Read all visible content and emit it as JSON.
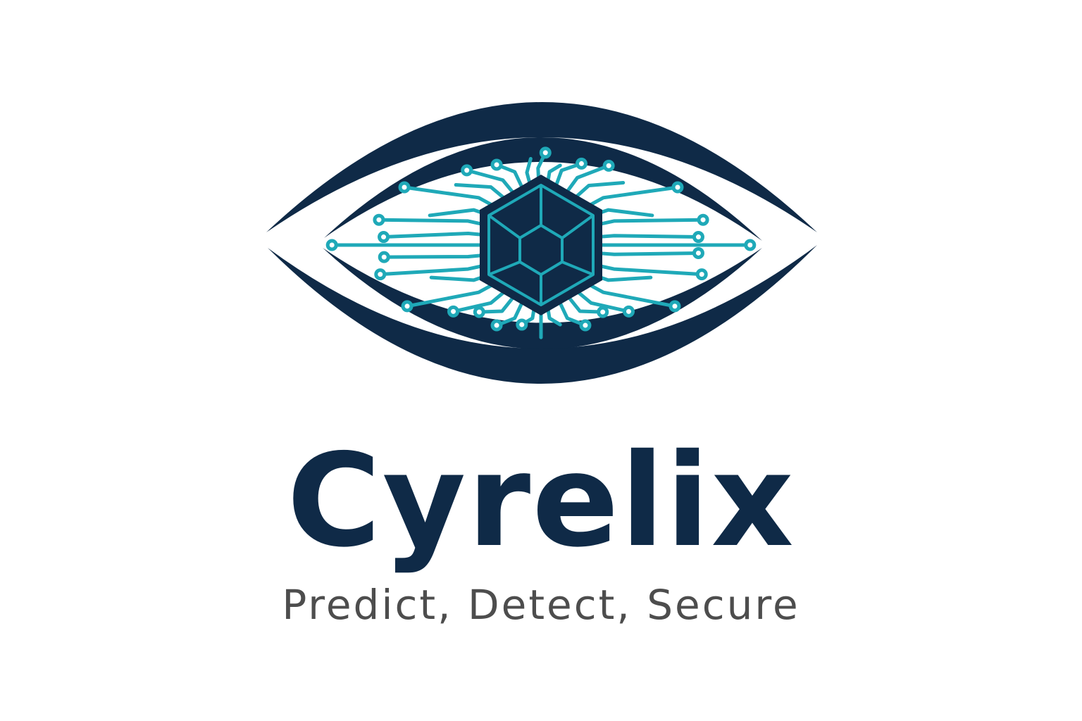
{
  "brand": {
    "name": "Cyrelix",
    "tagline": "Predict, Detect, Secure"
  },
  "logo": {
    "icon": "eye-with-circuit-hexagon-icon"
  },
  "colors": {
    "navy": "#0f2a47",
    "teal": "#1fa9b8",
    "tagline_gray": "#4d4d4d",
    "background": "#ffffff"
  }
}
